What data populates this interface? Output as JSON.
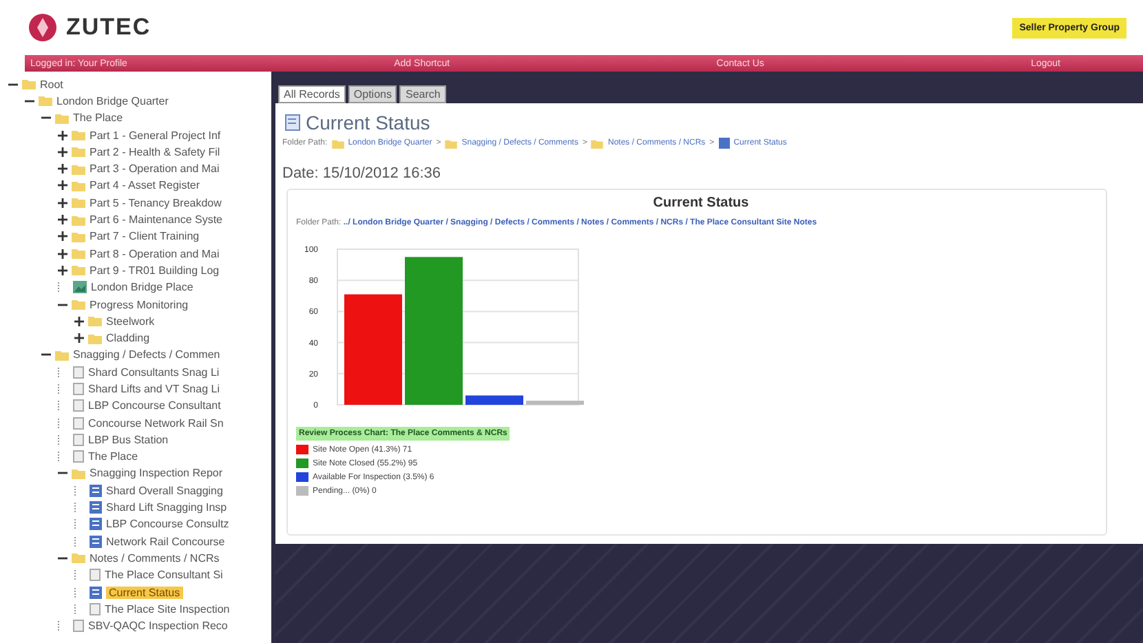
{
  "header": {
    "logo": "ZUTEC",
    "badge": "Seller Property Group"
  },
  "nav": [
    "Logged in: Your Profile",
    "Add Shortcut",
    "Contact Us",
    "Logout"
  ],
  "tree": [
    {
      "label": "Root",
      "kind": "folder",
      "expanded": true,
      "selected": false,
      "children": [
        {
          "label": "London Bridge Quarter",
          "kind": "folder",
          "expanded": true,
          "selected": false,
          "children": [
            {
              "label": "The Place",
              "kind": "folder",
              "expanded": true,
              "selected": false,
              "children": [
                {
                  "label": "Part 1 - General Project Inf",
                  "kind": "folder",
                  "expanded": false,
                  "selected": false
                },
                {
                  "label": "Part 2 - Health & Safety Fil",
                  "kind": "folder",
                  "expanded": false,
                  "selected": false
                },
                {
                  "label": "Part 3 - Operation and Mai",
                  "kind": "folder",
                  "expanded": false,
                  "selected": false
                },
                {
                  "label": "Part 4 - Asset Register",
                  "kind": "folder",
                  "expanded": false,
                  "selected": false
                },
                {
                  "label": "Part 5 - Tenancy Breakdow",
                  "kind": "folder",
                  "expanded": false,
                  "selected": false
                },
                {
                  "label": "Part 6 - Maintenance Syste",
                  "kind": "folder",
                  "expanded": false,
                  "selected": false
                },
                {
                  "label": "Part 7 - Client Training",
                  "kind": "folder",
                  "expanded": false,
                  "selected": false
                },
                {
                  "label": "Part 8 - Operation and Mai",
                  "kind": "folder",
                  "expanded": false,
                  "selected": false
                },
                {
                  "label": "Part 9 - TR01 Building Log",
                  "kind": "folder",
                  "expanded": false,
                  "selected": false
                },
                {
                  "label": "London Bridge Place",
                  "kind": "image",
                  "selected": false
                },
                {
                  "label": "Progress Monitoring",
                  "kind": "folder",
                  "expanded": true,
                  "selected": false,
                  "children": [
                    {
                      "label": "Steelwork",
                      "kind": "folder",
                      "expanded": false,
                      "selected": false
                    },
                    {
                      "label": "Cladding",
                      "kind": "folder",
                      "expanded": false,
                      "selected": false
                    }
                  ]
                }
              ]
            },
            {
              "label": "Snagging / Defects / Commen",
              "kind": "folder",
              "expanded": true,
              "selected": false,
              "children": [
                {
                  "label": "Shard Consultants Snag Li",
                  "kind": "page",
                  "selected": false
                },
                {
                  "label": "Shard Lifts and VT Snag Li",
                  "kind": "page",
                  "selected": false
                },
                {
                  "label": "LBP Concourse Consultant",
                  "kind": "page",
                  "selected": false
                },
                {
                  "label": "Concourse Network Rail Sn",
                  "kind": "page",
                  "selected": false
                },
                {
                  "label": "LBP Bus Station",
                  "kind": "page",
                  "selected": false
                },
                {
                  "label": "The Place",
                  "kind": "page",
                  "selected": false
                },
                {
                  "label": "Snagging Inspection Repor",
                  "kind": "folder",
                  "expanded": true,
                  "selected": false,
                  "children": [
                    {
                      "label": "Shard Overall Snagging",
                      "kind": "report",
                      "selected": false
                    },
                    {
                      "label": "Shard Lift Snagging Insp",
                      "kind": "report",
                      "selected": false
                    },
                    {
                      "label": "LBP Concourse Consultz",
                      "kind": "report",
                      "selected": false
                    },
                    {
                      "label": "Network Rail Concourse",
                      "kind": "report",
                      "selected": false
                    }
                  ]
                },
                {
                  "label": "Notes / Comments / NCRs",
                  "kind": "folder",
                  "expanded": true,
                  "selected": false,
                  "children": [
                    {
                      "label": "The Place Consultant Si",
                      "kind": "page",
                      "selected": false
                    },
                    {
                      "label": "Current Status",
                      "kind": "report",
                      "selected": true
                    },
                    {
                      "label": "The Place Site Inspection",
                      "kind": "page",
                      "selected": false
                    }
                  ]
                },
                {
                  "label": "SBV-QAQC Inspection Reco",
                  "kind": "page",
                  "selected": false
                }
              ]
            }
          ]
        }
      ]
    }
  ],
  "tabs": [
    {
      "label": "All Records",
      "selected": true
    },
    {
      "label": "Options",
      "selected": false
    },
    {
      "label": "Search",
      "selected": false
    }
  ],
  "page": {
    "title": "Current Status",
    "path_label": "Folder Path:",
    "separator": ">",
    "path": [
      {
        "label": "London Bridge Quarter",
        "kind": "folder"
      },
      {
        "label": "Snagging / Defects / Comments",
        "kind": "folder"
      },
      {
        "label": "Notes / Comments / NCRs",
        "kind": "folder"
      },
      {
        "label": "Current Status",
        "kind": "report"
      }
    ],
    "date": "Date: 15/10/2012 16:36"
  },
  "report": {
    "title": "Current Status",
    "path_label": "Folder Path:",
    "path": "../ London Bridge Quarter / Snagging / Defects / Comments / Notes / Comments / NCRs / The Place Consultant Site Notes",
    "chart_data": {
      "type": "bar",
      "grid": true,
      "ylim": [
        0,
        100
      ],
      "yticks": [
        0,
        20,
        40,
        60,
        80,
        100
      ],
      "series": [
        {
          "name": "Site Note Open (41.3%) 71",
          "color": "#ee1111",
          "values": [
            71
          ]
        },
        {
          "name": "Site Note Closed (55.2%) 95",
          "color": "#229922",
          "values": [
            95
          ]
        },
        {
          "name": "Available For Inspection (3.5%) 6",
          "color": "#2244dd",
          "values": [
            6
          ]
        },
        {
          "name": "Pending... (0%) 0",
          "color": "#bbbbbb",
          "values": [
            0
          ]
        }
      ]
    },
    "legend_title": "Review Process Chart: The Place Comments & NCRs"
  }
}
